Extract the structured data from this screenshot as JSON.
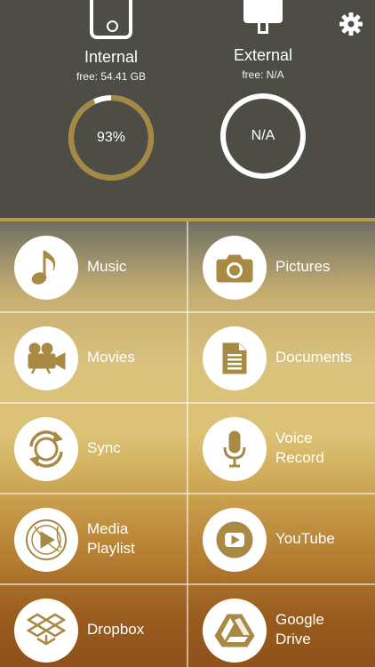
{
  "storage": {
    "internal": {
      "label": "Internal",
      "free": "free: 54.41 GB",
      "percent_text": "93%",
      "used_fraction": 0.93
    },
    "external": {
      "label": "External",
      "free": "free: N/A",
      "percent_text": "N/A"
    }
  },
  "colors": {
    "header_bg": "#4d4d45",
    "accent_gold": "#b99a48",
    "icon_gold": "#a88a45",
    "white": "#ffffff"
  },
  "tiles": [
    {
      "label": "Music",
      "icon": "music-note-icon"
    },
    {
      "label": "Pictures",
      "icon": "camera-icon"
    },
    {
      "label": "Movies",
      "icon": "movie-camera-icon"
    },
    {
      "label": "Documents",
      "icon": "document-icon"
    },
    {
      "label": "Sync",
      "icon": "sync-icon"
    },
    {
      "label": "Voice\nRecord",
      "icon": "microphone-icon"
    },
    {
      "label": "Media\nPlaylist",
      "icon": "playlist-icon"
    },
    {
      "label": "YouTube",
      "icon": "youtube-icon"
    },
    {
      "label": "Dropbox",
      "icon": "dropbox-icon"
    },
    {
      "label": "Google\nDrive",
      "icon": "google-drive-icon"
    }
  ]
}
